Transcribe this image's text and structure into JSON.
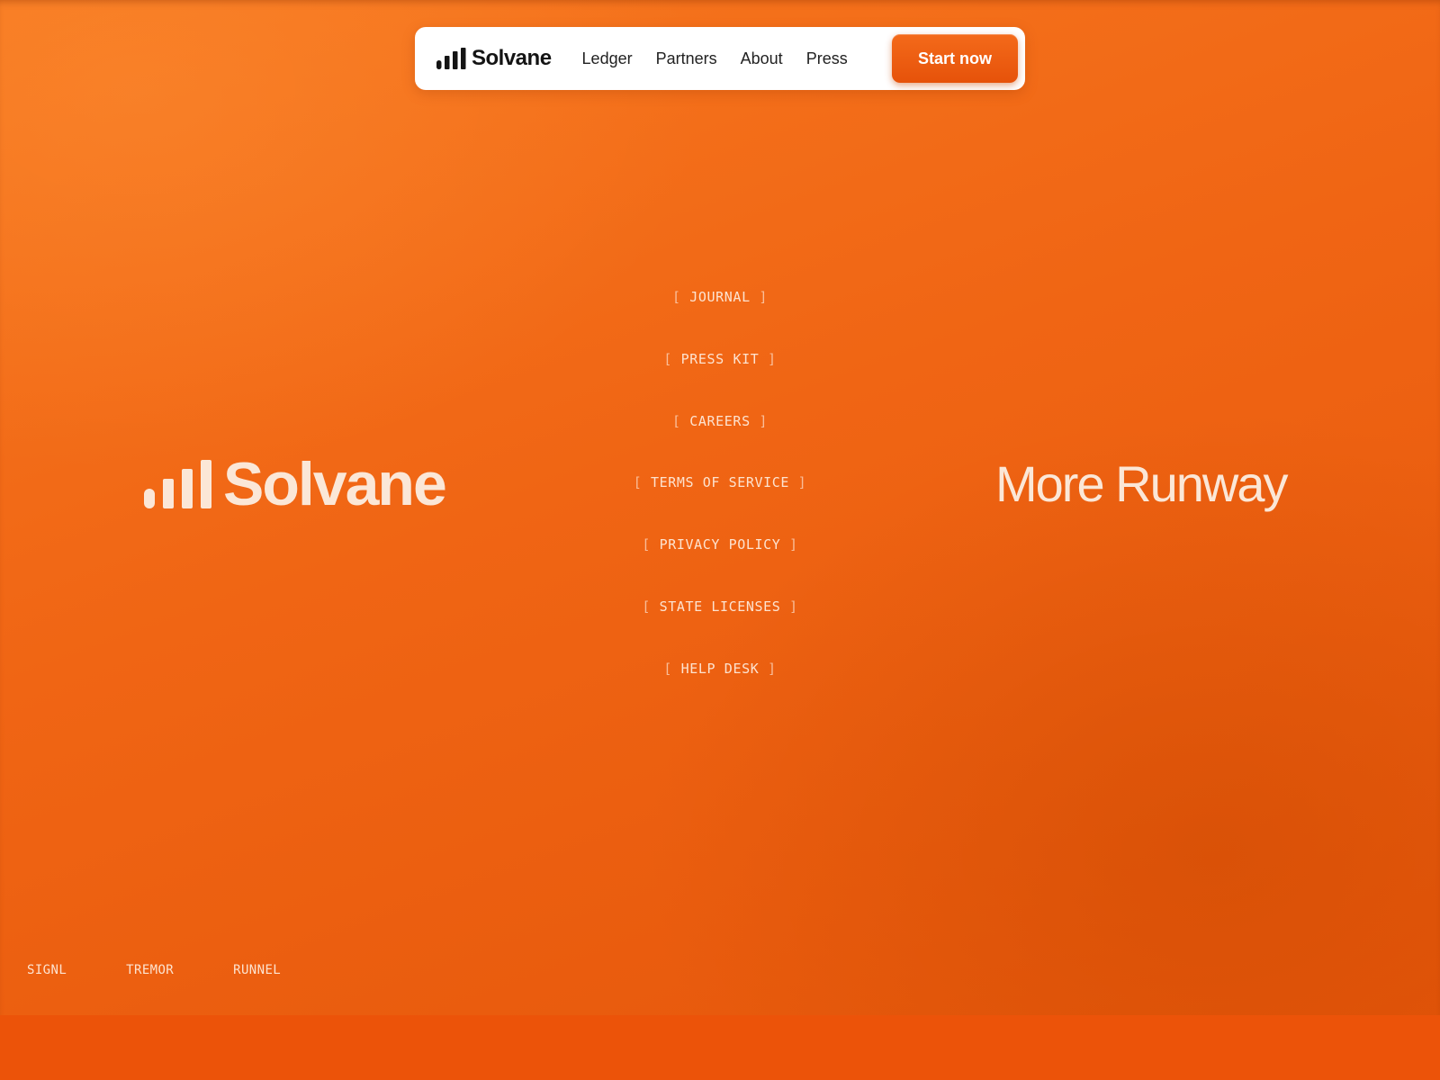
{
  "brand": {
    "name": "Solvane",
    "logo_icon": "signal-bars-icon"
  },
  "nav": {
    "links": [
      {
        "label": "Ledger"
      },
      {
        "label": "Partners"
      },
      {
        "label": "About"
      },
      {
        "label": "Press"
      }
    ],
    "cta_label": "Start now"
  },
  "hero": {
    "tagline": "More Runway"
  },
  "footer": {
    "links": [
      {
        "label": "JOURNAL"
      },
      {
        "label": "PRESS KIT"
      },
      {
        "label": "CAREERS"
      },
      {
        "label": "TERMS OF SERVICE"
      },
      {
        "label": "PRIVACY POLICY"
      },
      {
        "label": "STATE LICENSES"
      },
      {
        "label": "HELP DESK"
      }
    ],
    "partners": [
      {
        "label": "SIGNL"
      },
      {
        "label": "TREMOR"
      },
      {
        "label": "RUNNEL"
      }
    ]
  },
  "colors": {
    "accent": "#f06514",
    "cta": "#ec5a0f",
    "text_light": "#fbe7d7",
    "text_dark": "#141414"
  }
}
